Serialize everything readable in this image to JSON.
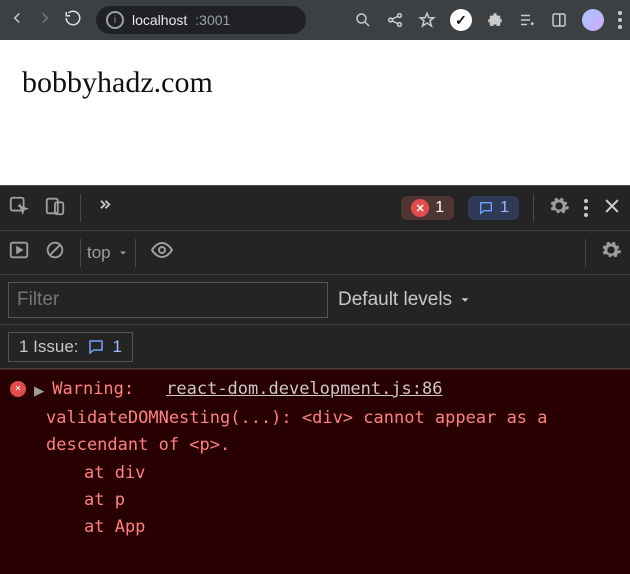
{
  "browser": {
    "url_host": "localhost",
    "url_port": ":3001",
    "info_icon_char": "i",
    "lastpass_char": "✓"
  },
  "page": {
    "heading": "bobbyhadz.com"
  },
  "devtools": {
    "error_count": "1",
    "message_count": "1",
    "context": "top",
    "filter_placeholder": "Filter",
    "levels_label": "Default levels",
    "issues_label": "1 Issue:",
    "issues_count": "1"
  },
  "console": {
    "warning_label": "Warning:",
    "source_file": "react-dom.development.js:86",
    "message": "validateDOMNesting(...): <div> cannot appear as a descendant of <p>.",
    "stack": [
      "at div",
      "at p",
      "at App"
    ]
  }
}
